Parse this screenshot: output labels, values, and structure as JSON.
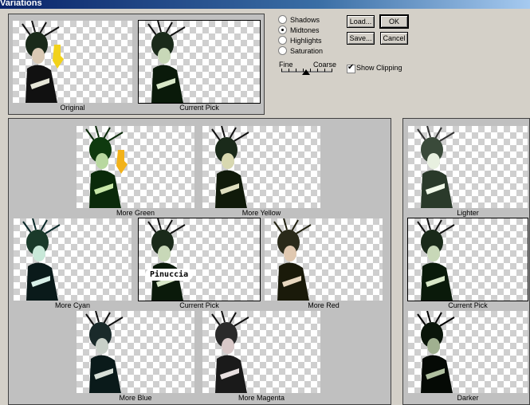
{
  "window": {
    "title": "Variations"
  },
  "top": {
    "original": "Original",
    "current_pick": "Current Pick"
  },
  "tones": [
    {
      "label": "Shadows",
      "checked": false
    },
    {
      "label": "Midtones",
      "checked": true
    },
    {
      "label": "Highlights",
      "checked": false
    },
    {
      "label": "Saturation",
      "checked": false
    }
  ],
  "buttons": {
    "load": "Load...",
    "save": "Save...",
    "ok": "OK",
    "cancel": "Cancel"
  },
  "slider": {
    "fine": "Fine",
    "coarse": "Coarse"
  },
  "clipping": {
    "label": "Show Clipping",
    "checked": true
  },
  "main": {
    "more_green": "More Green",
    "more_yellow": "More Yellow",
    "more_cyan": "More Cyan",
    "current_pick": "Current Pick",
    "more_red": "More Red",
    "more_blue": "More Blue",
    "more_magenta": "More Magenta",
    "watermark": "Pinuccia"
  },
  "side": {
    "lighter": "Lighter",
    "current_pick": "Current Pick",
    "darker": "Darker"
  }
}
